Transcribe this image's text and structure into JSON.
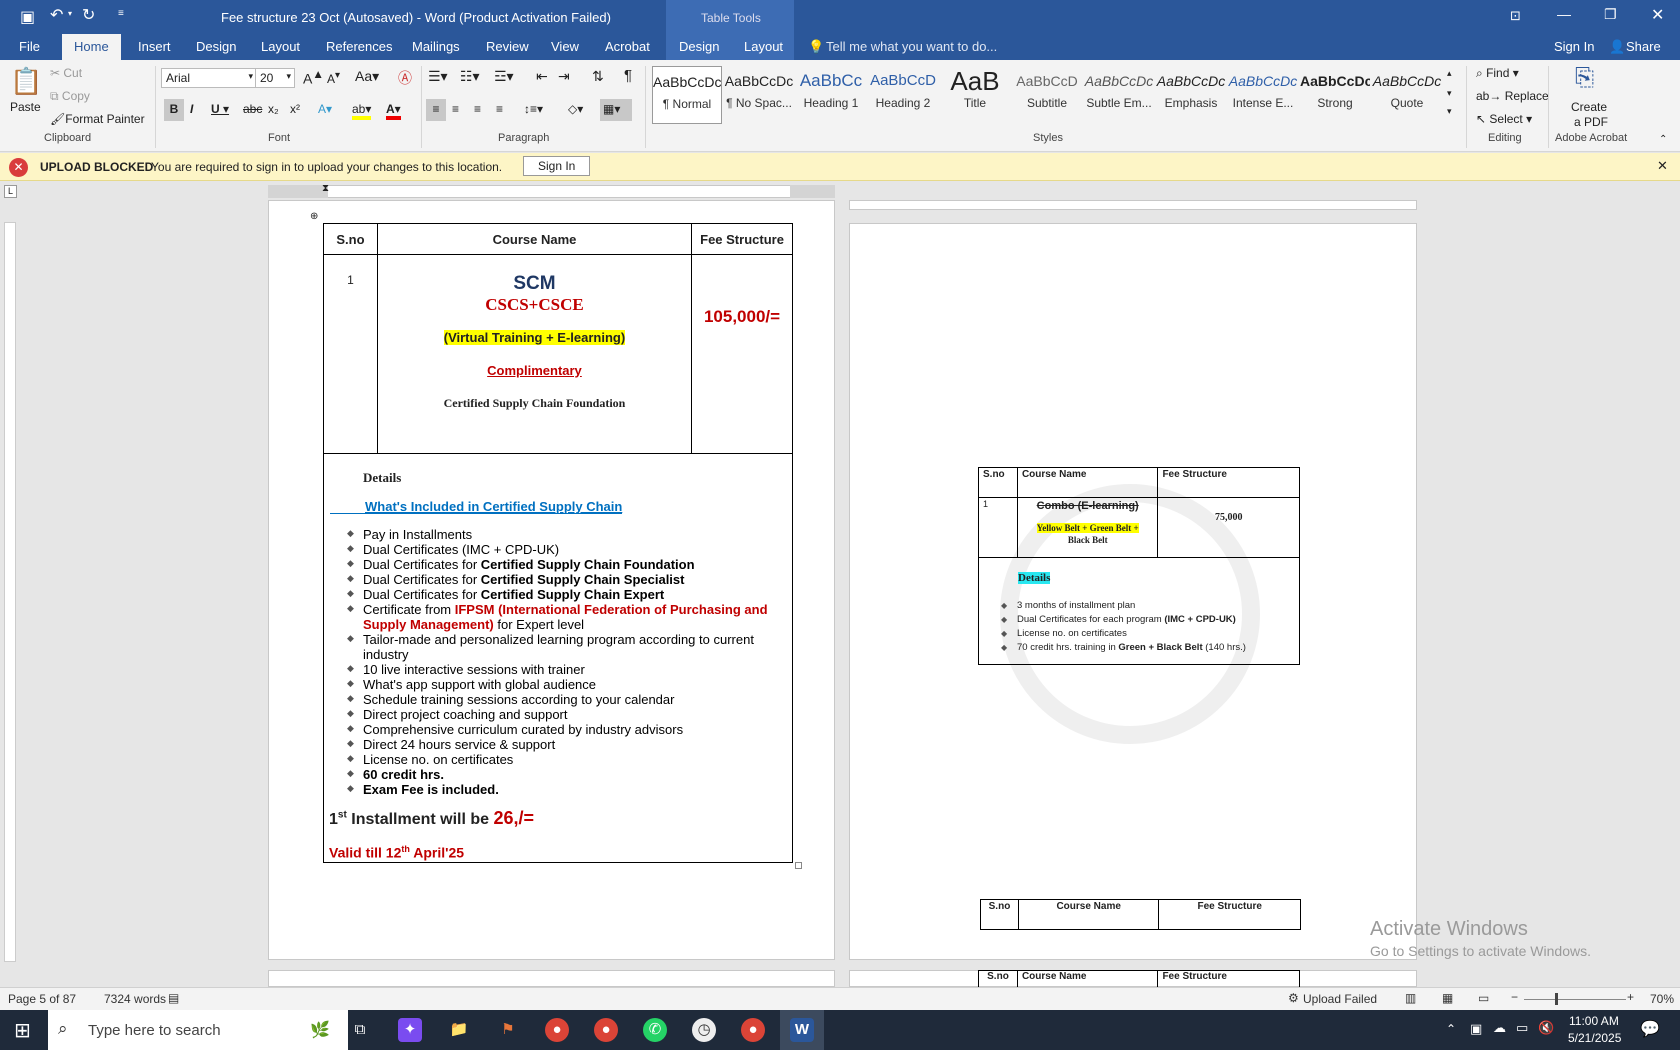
{
  "window": {
    "title": "Fee structure 23 Oct (Autosaved) - Word (Product Activation Failed)",
    "context_tab": "Table Tools"
  },
  "titlebar": {
    "signin": "Sign In",
    "share": "Share",
    "tell_me": "Tell me what you want to do..."
  },
  "tabs": [
    "File",
    "Home",
    "Insert",
    "Design",
    "Layout",
    "References",
    "Mailings",
    "Review",
    "View",
    "Acrobat",
    "Design",
    "Layout"
  ],
  "clipboard": {
    "paste": "Paste",
    "cut": "Cut",
    "copy": "Copy",
    "format_painter": "Format Painter",
    "group": "Clipboard"
  },
  "font": {
    "name": "Arial",
    "size": "20",
    "group": "Font"
  },
  "paragraph": {
    "group": "Paragraph"
  },
  "styles": {
    "group": "Styles",
    "items": [
      {
        "preview": "AaBbCcDc",
        "name": "¶ Normal"
      },
      {
        "preview": "AaBbCcDc",
        "name": "¶ No Spac..."
      },
      {
        "preview": "AaBbCc",
        "name": "Heading 1"
      },
      {
        "preview": "AaBbCcD",
        "name": "Heading 2"
      },
      {
        "preview": "AaB",
        "name": "Title"
      },
      {
        "preview": "AaBbCcD",
        "name": "Subtitle"
      },
      {
        "preview": "AaBbCcDc",
        "name": "Subtle Em..."
      },
      {
        "preview": "AaBbCcDc",
        "name": "Emphasis"
      },
      {
        "preview": "AaBbCcDc",
        "name": "Intense E..."
      },
      {
        "preview": "AaBbCcDc",
        "name": "Strong"
      },
      {
        "preview": "AaBbCcDc",
        "name": "Quote"
      }
    ]
  },
  "editing": {
    "find": "Find",
    "replace": "Replace",
    "select": "Select",
    "group": "Editing"
  },
  "acrobat": {
    "create": "Create",
    "pdf": "a PDF",
    "group": "Adobe Acrobat"
  },
  "banner": {
    "title": "UPLOAD BLOCKED",
    "message": "You are required to sign in to upload your changes to this location.",
    "button": "Sign In"
  },
  "doc": {
    "headers": {
      "sno": "S.no",
      "course": "Course Name",
      "fee": "Fee Structure"
    },
    "row1": {
      "sno": "1",
      "scm": "SCM",
      "cscs": "CSCS+CSCE",
      "virtual": "(Virtual Training + E-learning)",
      "compl": "Complimentary",
      "cert": "Certified Supply Chain Foundation",
      "fee": "105,000/="
    },
    "details": "Details",
    "included": "What's Included in Certified Supply Chain",
    "items": [
      {
        "a": "Pay in Installments",
        "b": "",
        "c": ""
      },
      {
        "a": "Dual Certificates (IMC + CPD-UK)",
        "b": "",
        "c": ""
      },
      {
        "a": "Dual Certificates for ",
        "b": "Certified Supply Chain Foundation",
        "c": ""
      },
      {
        "a": "Dual Certificates for ",
        "b": "Certified Supply Chain Specialist",
        "c": ""
      },
      {
        "a": "Dual Certificates for ",
        "b": "Certified Supply Chain Expert",
        "c": ""
      }
    ],
    "ifpsm": {
      "a": "Certificate from ",
      "red": "IFPSM",
      "b": " (International Federation of Purchasing and",
      "b2": "Supply Management)",
      "c": " for Expert level"
    },
    "items2": [
      "Tailor-made and personalized learning program according to current",
      "industry",
      "10 live interactive sessions with trainer",
      "What's app support with global audience",
      "Schedule training sessions according to your calendar",
      "Direct project coaching and support",
      "Comprehensive curriculum curated by industry advisors",
      "Direct 24 hours service & support",
      "License no. on certificates"
    ],
    "bold_items": [
      "60 credit hrs.",
      "Exam Fee is included."
    ],
    "install": {
      "pre": "1",
      "sup": "st",
      "mid": " Installment will be ",
      "amount": "26,/="
    },
    "valid": {
      "a": "Valid till 12",
      "sup": "th",
      "b": " April'25"
    }
  },
  "doc2": {
    "headers": {
      "sno": "S.no",
      "course": "Course Name",
      "fee": "Fee Structure"
    },
    "row": {
      "sno": "1",
      "combo": "Combo (E-learning)",
      "belts": "Yellow Belt + Green Belt +",
      "belts2": "Black Belt",
      "fee": "75,000"
    },
    "details": "Details",
    "items": [
      "3 months of installment plan",
      "Dual Certificates for each program ",
      "License no. on certificates",
      "70 credit hrs. training in "
    ],
    "bolds": [
      "(IMC + CPD-UK)",
      "Green + Black Belt"
    ],
    "tail": " (140 hrs.)"
  },
  "watermark": {
    "title": "Activate Windows",
    "sub": "Go to Settings to activate Windows."
  },
  "status": {
    "page": "Page 5 of 87",
    "words": "7324 words",
    "upload": "Upload Failed",
    "zoom": "70%"
  },
  "taskbar": {
    "search": "Type here to search",
    "time": "11:00 AM",
    "date": "5/21/2025"
  }
}
